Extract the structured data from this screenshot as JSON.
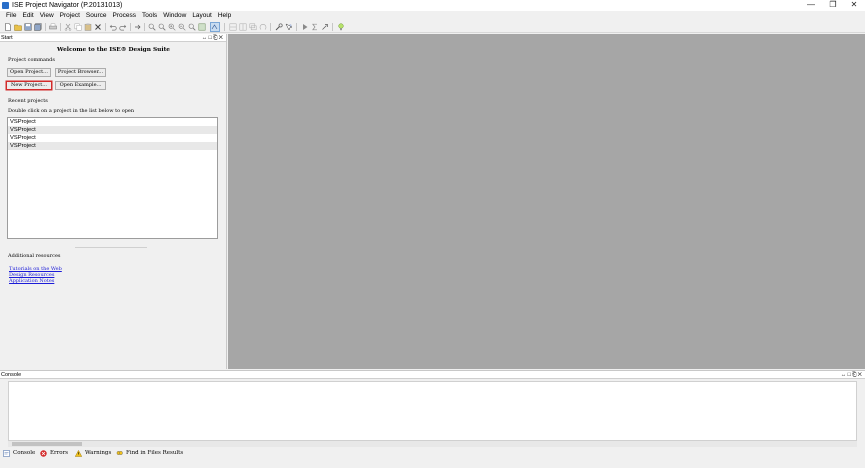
{
  "window": {
    "title": "ISE Project Navigator (P.20131013)",
    "minimize_glyph": "—",
    "restore_glyph": "❐",
    "close_glyph": "✕"
  },
  "menu": [
    "File",
    "Edit",
    "View",
    "Project",
    "Source",
    "Process",
    "Tools",
    "Window",
    "Layout",
    "Help"
  ],
  "start_panel": {
    "title": "Start",
    "controls": "↔□⎗✕",
    "welcome": "Welcome to the ISE® Design Suite",
    "commands_label": "Project commands",
    "open_project": "Open Project...",
    "project_browser": "Project Browser...",
    "new_project": "New Project...",
    "open_example": "Open Example...",
    "recent_label": "Recent projects",
    "recent_hint": "Double click on a project in the list below to open",
    "recent_projects": [
      "VSProject",
      "VSProject",
      "VSProject",
      "VSProject"
    ],
    "resources_label": "Additional resources",
    "links": [
      "Tutorials on the Web",
      "Design Resources",
      "Application Notes"
    ]
  },
  "console": {
    "title": "Console",
    "controls": "↔□⎗✕"
  },
  "bottom_tabs": {
    "console": "Console",
    "errors": "Errors",
    "warnings": "Warnings",
    "find": "Find in Files Results"
  },
  "colors": {
    "workspace_bg": "#a6a6a6",
    "focus_border": "#d22b2b",
    "link": "#1b1bd8"
  }
}
